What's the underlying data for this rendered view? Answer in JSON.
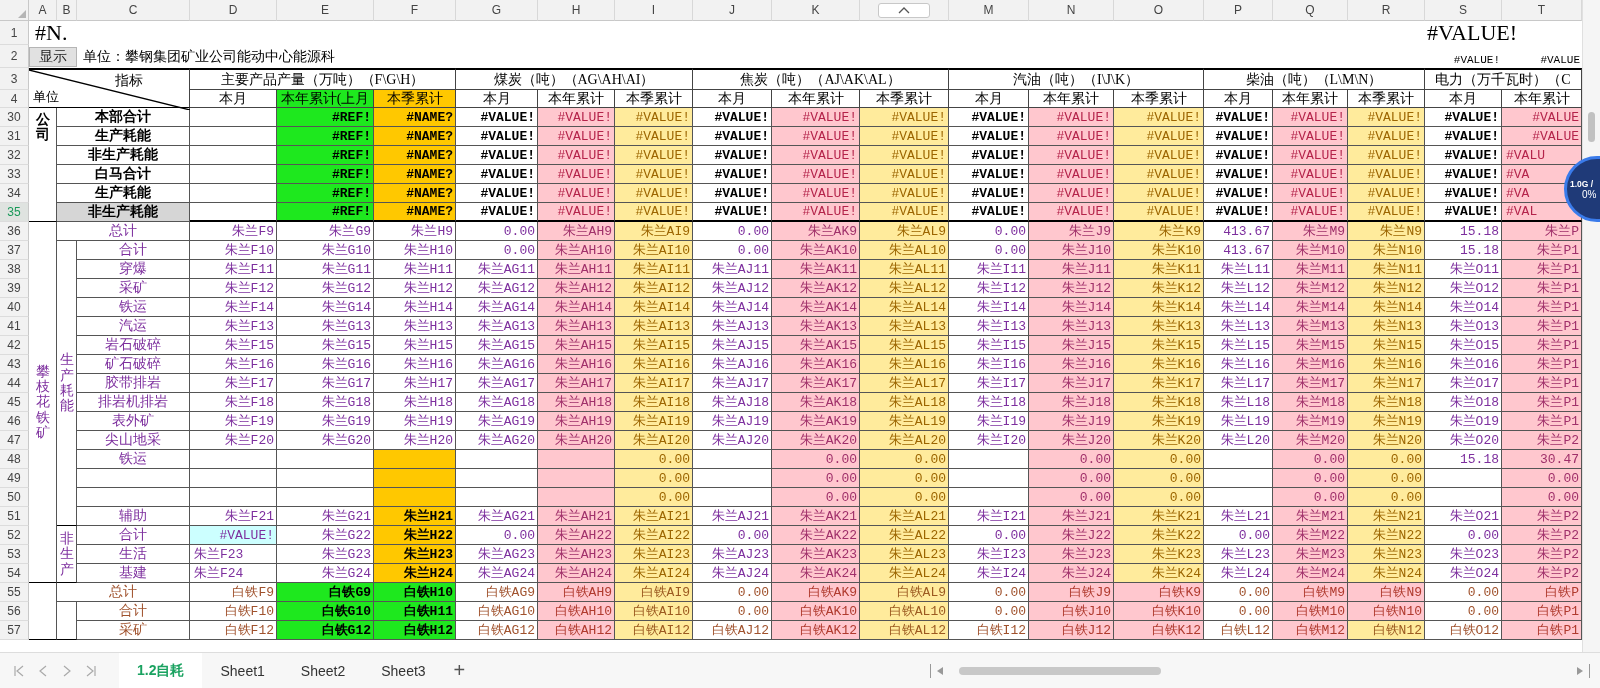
{
  "columns": [
    {
      "letter": "A"
    },
    {
      "letter": "B"
    },
    {
      "letter": "C"
    },
    {
      "letter": "D",
      "color": "#ffffff"
    },
    {
      "letter": "E",
      "color": "#ffffff"
    },
    {
      "letter": "F",
      "color": "#ffffff"
    },
    {
      "letter": "G",
      "color": "#ffffff"
    },
    {
      "letter": "H",
      "color": "#ffc7ce"
    },
    {
      "letter": "I",
      "color": "#ffeb9c"
    },
    {
      "letter": "J",
      "color": "#ffffff"
    },
    {
      "letter": "K",
      "color": "#ffc7ce"
    },
    {
      "kind": "collapse",
      "color": "#ffeb9c"
    },
    {
      "letter": "M",
      "color": "#ffffff"
    },
    {
      "letter": "N",
      "color": "#ffc7ce"
    },
    {
      "letter": "O",
      "color": "#ffeb9c"
    },
    {
      "letter": "P",
      "color": "#ffffff"
    },
    {
      "letter": "Q",
      "color": "#ffc7ce"
    },
    {
      "letter": "R",
      "color": "#ffeb9c"
    },
    {
      "letter": "S",
      "color": "#ffffff"
    },
    {
      "letter": "T",
      "color": "#ffc7ce"
    }
  ],
  "title_row": {
    "row": "1",
    "left": "#N.",
    "right": "#VALUE!"
  },
  "info_row": {
    "row": "2",
    "button": "显示",
    "unit": "单位：攀钢集团矿业公司能动中心能源科",
    "values": [
      "#VALUE!",
      "#VALUE"
    ]
  },
  "header": {
    "rows": [
      "3",
      "4"
    ],
    "corner_top": "指标",
    "corner_bottom": "单位",
    "groups": [
      {
        "title": "主要产品产量（万吨）（F\\G\\H）",
        "subs": [
          {
            "label": "本月",
            "color": "#ffffff"
          },
          {
            "label": "本年累计(上月",
            "color": "#1ee81e"
          },
          {
            "label": "本季累计",
            "color": "#ffc800"
          }
        ]
      },
      {
        "title": "煤炭（吨）（AG\\AH\\AI）",
        "subs": [
          {
            "label": "本月",
            "color": "#ffffff"
          },
          {
            "label": "本年累计",
            "color": "#ffffff"
          },
          {
            "label": "本季累计",
            "color": "#ffffff"
          }
        ]
      },
      {
        "title": "焦炭（吨）（AJ\\AK\\AL）",
        "subs": [
          {
            "label": "本月",
            "color": "#ffffff"
          },
          {
            "label": "本年累计",
            "color": "#ffffff"
          },
          {
            "label": "本季累计",
            "color": "#ffffff"
          }
        ]
      },
      {
        "title": "汽油（吨）（I\\J\\K）",
        "subs": [
          {
            "label": "本月",
            "color": "#ffffff"
          },
          {
            "label": "本年累计",
            "color": "#ffffff"
          },
          {
            "label": "本季累计",
            "color": "#ffffff"
          }
        ]
      },
      {
        "title": "柴油（吨）（L\\M\\N）",
        "subs": [
          {
            "label": "本月",
            "color": "#ffffff"
          },
          {
            "label": "本年累计",
            "color": "#ffffff"
          },
          {
            "label": "本季累计",
            "color": "#ffffff"
          }
        ]
      },
      {
        "title": "电力（万千瓦时）（C",
        "subs": [
          {
            "label": "本月",
            "color": "#ffffff"
          },
          {
            "label": "本年累计",
            "color": "#ffffff"
          }
        ]
      }
    ]
  },
  "blocks": [
    {
      "kind": "company",
      "label": "公司",
      "rows": [
        {
          "row": "30",
          "label": "本部合计",
          "selected": false,
          "cells": [
            null,
            {
              "text": "#REF!",
              "color": "#1ee81e"
            },
            {
              "text": "#NAME?",
              "color": "#ffc800"
            },
            "#VALUE!",
            "#VALUE!",
            "#VALUE!",
            "#VALUE!",
            "#VALUE!",
            "#VALUE!",
            "#VALUE!",
            "#VALUE!",
            "#VALUE!",
            "#VALUE!",
            "#VALUE!",
            "#VALUE!",
            "#VALUE!",
            "#VALUE"
          ]
        },
        {
          "row": "31",
          "label": "生产耗能",
          "selected": false,
          "cells": [
            null,
            {
              "text": "#REF!",
              "color": "#1ee81e"
            },
            {
              "text": "#NAME?",
              "color": "#ffc800"
            },
            "#VALUE!",
            "#VALUE!",
            "#VALUE!",
            "#VALUE!",
            "#VALUE!",
            "#VALUE!",
            "#VALUE!",
            "#VALUE!",
            "#VALUE!",
            "#VALUE!",
            "#VALUE!",
            "#VALUE!",
            "#VALUE!",
            "#VALUE"
          ]
        },
        {
          "row": "32",
          "label": "非生产耗能",
          "selected": false,
          "cells": [
            null,
            {
              "text": "#REF!",
              "color": "#1ee81e"
            },
            {
              "text": "#NAME?",
              "color": "#ffc800"
            },
            "#VALUE!",
            "#VALUE!",
            "#VALUE!",
            "#VALUE!",
            "#VALUE!",
            "#VALUE!",
            "#VALUE!",
            "#VALUE!",
            "#VALUE!",
            "#VALUE!",
            "#VALUE!",
            "#VALUE!",
            "#VALUE!",
            {
              "text": "#VALU",
              "kind": "left"
            }
          ]
        },
        {
          "row": "33",
          "label": "白马合计",
          "selected": false,
          "cells": [
            null,
            {
              "text": "#REF!",
              "color": "#1ee81e"
            },
            {
              "text": "#NAME?",
              "color": "#ffc800"
            },
            "#VALUE!",
            "#VALUE!",
            "#VALUE!",
            "#VALUE!",
            "#VALUE!",
            "#VALUE!",
            "#VALUE!",
            "#VALUE!",
            "#VALUE!",
            "#VALUE!",
            "#VALUE!",
            "#VALUE!",
            "#VALUE!",
            {
              "text": "#VA",
              "kind": "left"
            }
          ]
        },
        {
          "row": "34",
          "label": "生产耗能",
          "selected": false,
          "cells": [
            null,
            {
              "text": "#REF!",
              "color": "#1ee81e"
            },
            {
              "text": "#NAME?",
              "color": "#ffc800"
            },
            "#VALUE!",
            "#VALUE!",
            "#VALUE!",
            "#VALUE!",
            "#VALUE!",
            "#VALUE!",
            "#VALUE!",
            "#VALUE!",
            "#VALUE!",
            "#VALUE!",
            "#VALUE!",
            "#VALUE!",
            "#VALUE!",
            {
              "text": "#VA",
              "kind": "left"
            }
          ]
        },
        {
          "row": "35",
          "label": "非生产耗能",
          "selected": true,
          "cells": [
            null,
            {
              "text": "#REF!",
              "color": "#1ee81e"
            },
            {
              "text": "#NAME?",
              "color": "#ffc800"
            },
            "#VALUE!",
            "#VALUE!",
            "#VALUE!",
            "#VALUE!",
            "#VALUE!",
            "#VALUE!",
            "#VALUE!",
            "#VALUE!",
            "#VALUE!",
            "#VALUE!",
            "#VALUE!",
            "#VALUE!",
            "#VALUE!",
            {
              "text": "#VAL",
              "kind": "left"
            }
          ]
        }
      ]
    },
    {
      "kind": "purple",
      "label": "攀枝花铁矿",
      "rows": [
        {
          "row": "36",
          "label": "总计",
          "selected": false,
          "cells": [
            "朱兰F9",
            "朱兰G9",
            "朱兰H9",
            "0.00",
            "朱兰AH9",
            "朱兰AI9",
            "0.00",
            "朱兰AK9",
            "朱兰AL9",
            "0.00",
            "朱兰J9",
            "朱兰K9",
            "413.67",
            "朱兰M9",
            "朱兰N9",
            "15.18",
            "朱兰P"
          ]
        }
      ],
      "subgroups": [
        {
          "label": "生产耗能",
          "rows": [
            {
              "row": "37",
              "label": "合计",
              "selected": false,
              "cells": [
                "朱兰F10",
                "朱兰G10",
                "朱兰H10",
                "0.00",
                "朱兰AH10",
                "朱兰AI10",
                "0.00",
                "朱兰AK10",
                "朱兰AL10",
                "0.00",
                "朱兰J10",
                "朱兰K10",
                "413.67",
                "朱兰M10",
                "朱兰N10",
                "15.18",
                "朱兰P1"
              ]
            },
            {
              "row": "38",
              "label": "穿爆",
              "selected": false,
              "cells": [
                "朱兰F11",
                "朱兰G11",
                "朱兰H11",
                "朱兰AG11",
                "朱兰AH11",
                "朱兰AI11",
                "朱兰AJ11",
                "朱兰AK11",
                "朱兰AL11",
                "朱兰I11",
                "朱兰J11",
                "朱兰K11",
                "朱兰L11",
                "朱兰M11",
                "朱兰N11",
                "朱兰O11",
                "朱兰P1"
              ]
            },
            {
              "row": "39",
              "label": "采矿",
              "selected": false,
              "cells": [
                "朱兰F12",
                "朱兰G12",
                "朱兰H12",
                "朱兰AG12",
                "朱兰AH12",
                "朱兰AI12",
                "朱兰AJ12",
                "朱兰AK12",
                "朱兰AL12",
                "朱兰I12",
                "朱兰J12",
                "朱兰K12",
                "朱兰L12",
                "朱兰M12",
                "朱兰N12",
                "朱兰O12",
                "朱兰P1"
              ]
            },
            {
              "row": "40",
              "label": "铁运",
              "selected": false,
              "cells": [
                "朱兰F14",
                "朱兰G14",
                "朱兰H14",
                "朱兰AG14",
                "朱兰AH14",
                "朱兰AI14",
                "朱兰AJ14",
                "朱兰AK14",
                "朱兰AL14",
                "朱兰I14",
                "朱兰J14",
                "朱兰K14",
                "朱兰L14",
                "朱兰M14",
                "朱兰N14",
                "朱兰O14",
                "朱兰P1"
              ]
            },
            {
              "row": "41",
              "label": "汽运",
              "selected": false,
              "cells": [
                "朱兰F13",
                "朱兰G13",
                "朱兰H13",
                "朱兰AG13",
                "朱兰AH13",
                "朱兰AI13",
                "朱兰AJ13",
                "朱兰AK13",
                "朱兰AL13",
                "朱兰I13",
                "朱兰J13",
                "朱兰K13",
                "朱兰L13",
                "朱兰M13",
                "朱兰N13",
                "朱兰O13",
                "朱兰P1"
              ]
            },
            {
              "row": "42",
              "label": "岩石破碎",
              "selected": false,
              "cells": [
                "朱兰F15",
                "朱兰G15",
                "朱兰H15",
                "朱兰AG15",
                "朱兰AH15",
                "朱兰AI15",
                "朱兰AJ15",
                "朱兰AK15",
                "朱兰AL15",
                "朱兰I15",
                "朱兰J15",
                "朱兰K15",
                "朱兰L15",
                "朱兰M15",
                "朱兰N15",
                "朱兰O15",
                "朱兰P1"
              ]
            },
            {
              "row": "43",
              "label": "矿石破碎",
              "selected": false,
              "cells": [
                "朱兰F16",
                "朱兰G16",
                "朱兰H16",
                "朱兰AG16",
                "朱兰AH16",
                "朱兰AI16",
                "朱兰AJ16",
                "朱兰AK16",
                "朱兰AL16",
                "朱兰I16",
                "朱兰J16",
                "朱兰K16",
                "朱兰L16",
                "朱兰M16",
                "朱兰N16",
                "朱兰O16",
                "朱兰P1"
              ]
            },
            {
              "row": "44",
              "label": "胶带排岩",
              "selected": false,
              "cells": [
                "朱兰F17",
                "朱兰G17",
                "朱兰H17",
                "朱兰AG17",
                "朱兰AH17",
                "朱兰AI17",
                "朱兰AJ17",
                "朱兰AK17",
                "朱兰AL17",
                "朱兰I17",
                "朱兰J17",
                "朱兰K17",
                "朱兰L17",
                "朱兰M17",
                "朱兰N17",
                "朱兰O17",
                "朱兰P1"
              ]
            },
            {
              "row": "45",
              "label": "排岩机排岩",
              "selected": false,
              "cells": [
                "朱兰F18",
                "朱兰G18",
                "朱兰H18",
                "朱兰AG18",
                "朱兰AH18",
                "朱兰AI18",
                "朱兰AJ18",
                "朱兰AK18",
                "朱兰AL18",
                "朱兰I18",
                "朱兰J18",
                "朱兰K18",
                "朱兰L18",
                "朱兰M18",
                "朱兰N18",
                "朱兰O18",
                "朱兰P1"
              ]
            },
            {
              "row": "46",
              "label": "表外矿",
              "selected": false,
              "cells": [
                "朱兰F19",
                "朱兰G19",
                "朱兰H19",
                "朱兰AG19",
                "朱兰AH19",
                "朱兰AI19",
                "朱兰AJ19",
                "朱兰AK19",
                "朱兰AL19",
                "朱兰I19",
                "朱兰J19",
                "朱兰K19",
                "朱兰L19",
                "朱兰M19",
                "朱兰N19",
                "朱兰O19",
                "朱兰P1"
              ]
            },
            {
              "row": "47",
              "label": "尖山地采",
              "selected": false,
              "cells": [
                "朱兰F20",
                "朱兰G20",
                "朱兰H20",
                "朱兰AG20",
                "朱兰AH20",
                "朱兰AI20",
                "朱兰AJ20",
                "朱兰AK20",
                "朱兰AL20",
                "朱兰I20",
                "朱兰J20",
                "朱兰K20",
                "朱兰L20",
                "朱兰M20",
                "朱兰N20",
                "朱兰O20",
                "朱兰P2"
              ]
            },
            {
              "row": "48",
              "label": "铁运",
              "selected": false,
              "cells": [
                null,
                null,
                {
                  "color": "#ffc800"
                },
                null,
                null,
                "0.00",
                null,
                "0.00",
                "0.00",
                null,
                "0.00",
                "0.00",
                null,
                "0.00",
                "0.00",
                "15.18",
                "30.47"
              ]
            },
            {
              "row": "49",
              "selected": false,
              "cells": [
                null,
                null,
                {
                  "color": "#ffc800"
                },
                null,
                null,
                "0.00",
                null,
                "0.00",
                "0.00",
                null,
                "0.00",
                "0.00",
                null,
                "0.00",
                "0.00",
                null,
                "0.00"
              ]
            },
            {
              "row": "50",
              "selected": false,
              "cells": [
                null,
                null,
                {
                  "color": "#ffc800"
                },
                null,
                null,
                "0.00",
                null,
                "0.00",
                "0.00",
                null,
                "0.00",
                "0.00",
                null,
                "0.00",
                "0.00",
                null,
                "0.00"
              ]
            },
            {
              "row": "51",
              "label": "辅助",
              "selected": false,
              "cells": [
                "朱兰F21",
                "朱兰G21",
                {
                  "text": "朱兰H21",
                  "color": "#ffc800"
                },
                "朱兰AG21",
                "朱兰AH21",
                "朱兰AI21",
                "朱兰AJ21",
                "朱兰AK21",
                "朱兰AL21",
                "朱兰I21",
                "朱兰J21",
                "朱兰K21",
                "朱兰L21",
                "朱兰M21",
                "朱兰N21",
                "朱兰O21",
                "朱兰P2"
              ]
            }
          ]
        },
        {
          "label": "非生产",
          "rows": [
            {
              "row": "52",
              "label": "合计",
              "selected": false,
              "cells": [
                {
                  "text": "#VALUE!",
                  "color": "#ccffff"
                },
                "朱兰G22",
                {
                  "text": "朱兰H22",
                  "color": "#ffc800"
                },
                "0.00",
                "朱兰AH22",
                "朱兰AI22",
                "0.00",
                "朱兰AK22",
                "朱兰AL22",
                "0.00",
                "朱兰J22",
                "朱兰K22",
                "0.00",
                "朱兰M22",
                "朱兰N22",
                "0.00",
                "朱兰P2"
              ]
            },
            {
              "row": "53",
              "label": "生活",
              "selected": false,
              "cells": [
                {
                  "text": "朱兰F23",
                  "kind": "left"
                },
                "朱兰G23",
                {
                  "text": "朱兰H23",
                  "color": "#ffc800"
                },
                "朱兰AG23",
                "朱兰AH23",
                "朱兰AI23",
                "朱兰AJ23",
                "朱兰AK23",
                "朱兰AL23",
                "朱兰I23",
                "朱兰J23",
                "朱兰K23",
                "朱兰L23",
                "朱兰M23",
                "朱兰N23",
                "朱兰O23",
                "朱兰P2"
              ]
            },
            {
              "row": "54",
              "label": "基建",
              "selected": false,
              "cells": [
                {
                  "text": "朱兰F24",
                  "kind": "left"
                },
                "朱兰G24",
                {
                  "text": "朱兰H24",
                  "color": "#ffc800"
                },
                "朱兰AG24",
                "朱兰AH24",
                "朱兰AI24",
                "朱兰AJ24",
                "朱兰AK24",
                "朱兰AL24",
                "朱兰I24",
                "朱兰J24",
                "朱兰K24",
                "朱兰L24",
                "朱兰M24",
                "朱兰N24",
                "朱兰O24",
                "朱兰P2"
              ]
            }
          ]
        }
      ]
    },
    {
      "kind": "brown",
      "rows": [
        {
          "row": "55",
          "label": "总计",
          "selected": false,
          "cells": [
            "白铁F9",
            {
              "text": "白铁G9",
              "color": "#1ee81e"
            },
            {
              "text": "白铁H10",
              "color": "#1ee81e"
            },
            "白铁AG9",
            "白铁AH9",
            "白铁AI9",
            "0.00",
            "白铁AK9",
            "白铁AL9",
            "0.00",
            "白铁J9",
            {
              "text": "白铁K9",
              "color": "#ffc7ce"
            },
            "0.00",
            "白铁M9",
            {
              "text": "白铁N9",
              "color": "#ffc7ce"
            },
            "0.00",
            "白铁P"
          ]
        }
      ],
      "subgroups": [
        {
          "rows": [
            {
              "row": "56",
              "label": "合计",
              "selected": false,
              "cells": [
                "白铁F10",
                {
                  "text": "白铁G10",
                  "color": "#1ee81e"
                },
                {
                  "text": "白铁H11",
                  "color": "#1ee81e"
                },
                "白铁AG10",
                "白铁AH10",
                "白铁AI10",
                "0.00",
                "白铁AK10",
                "白铁AL10",
                "0.00",
                "白铁J10",
                {
                  "text": "白铁K10",
                  "color": "#ffc7ce"
                },
                "0.00",
                "白铁M10",
                {
                  "text": "白铁N10",
                  "color": "#ffc7ce"
                },
                "0.00",
                "白铁P1"
              ]
            },
            {
              "row": "57",
              "label": "采矿",
              "selected": false,
              "cells": [
                "白铁F12",
                {
                  "text": "白铁G12",
                  "color": "#1ee81e"
                },
                {
                  "text": "白铁H12",
                  "color": "#1ee81e"
                },
                "白铁AG12",
                "白铁AH12",
                "白铁AI12",
                "白铁AJ12",
                "白铁AK12",
                "白铁AL12",
                "白铁I12",
                "白铁J12",
                {
                  "text": "白铁K12",
                  "color": "#ffc7ce"
                },
                "白铁L12",
                "白铁M12",
                "白铁N12",
                "白铁O12",
                "白铁P1"
              ]
            }
          ]
        }
      ]
    }
  ],
  "sheet_tabs": [
    {
      "label": "1.2自耗",
      "selected": true
    },
    {
      "label": "Sheet1",
      "selected": false
    },
    {
      "label": "Sheet2",
      "selected": false
    },
    {
      "label": "Sheet3",
      "selected": false
    }
  ],
  "add_tab": "+",
  "speed_widget": {
    "speed": "1.0G /",
    "load": "0%"
  }
}
